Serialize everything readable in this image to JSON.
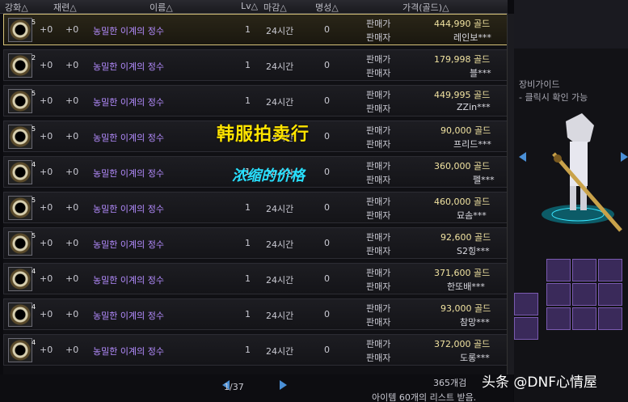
{
  "header": {
    "col_enhance": "강화△",
    "col_refine": "재련△",
    "col_name": "이름△",
    "col_lv": "Lv△",
    "col_time": "마감△",
    "col_fame": "명성△",
    "col_price": "가격(골드)△"
  },
  "rows": [
    {
      "enh": "+0",
      "ref": "+0",
      "name": "농밀한 이계의 정수",
      "lv": "1",
      "time": "24시간",
      "fame": "0",
      "label1": "판매가",
      "label2": "판매자",
      "price": "444,990 골드",
      "seller": "레인보***"
    },
    {
      "enh": "+0",
      "ref": "+0",
      "name": "농밀한 이계의 정수",
      "lv": "1",
      "time": "24시간",
      "fame": "0",
      "label1": "판매가",
      "label2": "판매자",
      "price": "179,998 골드",
      "seller": "블***"
    },
    {
      "enh": "+0",
      "ref": "+0",
      "name": "농밀한 이계의 정수",
      "lv": "1",
      "time": "24시간",
      "fame": "0",
      "label1": "판매가",
      "label2": "판매자",
      "price": "449,995 골드",
      "seller": "ZZin***"
    },
    {
      "enh": "+0",
      "ref": "+0",
      "name": "농밀한 이계의 정수",
      "lv": "1",
      "time": "24시간",
      "fame": "0",
      "label1": "판매가",
      "label2": "판매자",
      "price": "90,000 골드",
      "seller": "프리드***"
    },
    {
      "enh": "+0",
      "ref": "+0",
      "name": "농밀한 이계의 정수",
      "lv": "1",
      "time": "24시간",
      "fame": "0",
      "label1": "판매가",
      "label2": "판매자",
      "price": "360,000 골드",
      "seller": "펠***"
    },
    {
      "enh": "+0",
      "ref": "+0",
      "name": "농밀한 이계의 정수",
      "lv": "1",
      "time": "24시간",
      "fame": "0",
      "label1": "판매가",
      "label2": "판매자",
      "price": "460,000 골드",
      "seller": "묘솜***"
    },
    {
      "enh": "+0",
      "ref": "+0",
      "name": "농밀한 이계의 정수",
      "lv": "1",
      "time": "24시간",
      "fame": "0",
      "label1": "판매가",
      "label2": "판매자",
      "price": "92,600 골드",
      "seller": "S2힝***"
    },
    {
      "enh": "+0",
      "ref": "+0",
      "name": "농밀한 이계의 정수",
      "lv": "1",
      "time": "24시간",
      "fame": "0",
      "label1": "판매가",
      "label2": "판매자",
      "price": "371,600 골드",
      "seller": "한또배***"
    },
    {
      "enh": "+0",
      "ref": "+0",
      "name": "농밀한 이계의 정수",
      "lv": "1",
      "time": "24시간",
      "fame": "0",
      "label1": "판매가",
      "label2": "판매자",
      "price": "93,000 골드",
      "seller": "참망***"
    },
    {
      "enh": "+0",
      "ref": "+0",
      "name": "농밀한 이계의 정수",
      "lv": "1",
      "time": "24시간",
      "fame": "0",
      "label1": "판매가",
      "label2": "판매자",
      "price": "372,000 골드",
      "seller": "도롱***"
    }
  ],
  "icon_levels": [
    "5",
    "2",
    "5",
    "5",
    "4",
    "5",
    "5",
    "4",
    "4",
    "4"
  ],
  "pagination": {
    "text": "1/37"
  },
  "footer": {
    "count_text": "365개검",
    "list_text": "아이템 60개의 리스트 받음."
  },
  "right_panel": {
    "guide_title": "장비가이드",
    "guide_line": "- 클릭시 확인 가능"
  },
  "overlay": {
    "title": "韩服拍卖行",
    "subtitle": "浓缩的价格"
  },
  "watermark": "头条 @DNF心情屋",
  "colors": {
    "accent_gold": "#ffe400",
    "accent_cyan": "#28e0ff",
    "item_purple": "#b48cff",
    "selected_border": "#d6c27a"
  }
}
